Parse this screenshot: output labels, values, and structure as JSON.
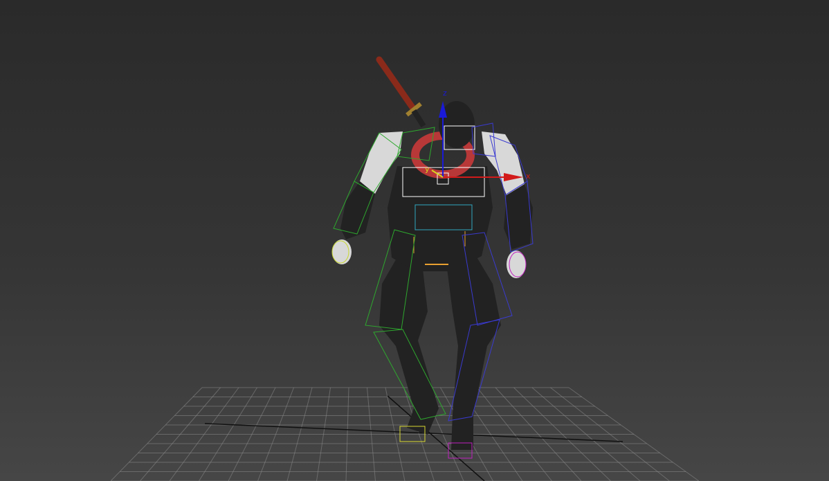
{
  "viewport": {
    "background_top": "#2a2a2a",
    "background_bottom": "#464646",
    "grid_color": "#8a8a8a",
    "grid_axis_color": "#101010"
  },
  "gizmo": {
    "x_label": "x",
    "y_label": "y",
    "z_label": "z",
    "x_color": "#d21a1a",
    "y_color": "#d8d820",
    "z_color": "#1a1ad8"
  },
  "biped": {
    "left_side_color": "#2ea82e",
    "right_side_color": "#3a3ad0",
    "spine_color": "#ffffff",
    "neck_color": "#30a8c0",
    "pelvis_color": "#e8a030",
    "left_hand_color": "#c8d830",
    "right_hand_color": "#c020c0",
    "left_foot_color": "#d8d830",
    "right_foot_color": "#c020c0"
  },
  "character": {
    "body_color": "#222222",
    "skin_color": "#d8d8d8",
    "scarf_color": "#b83838",
    "sword_handle_color": "#8a2a1a",
    "sword_guard_color": "#a08030"
  }
}
